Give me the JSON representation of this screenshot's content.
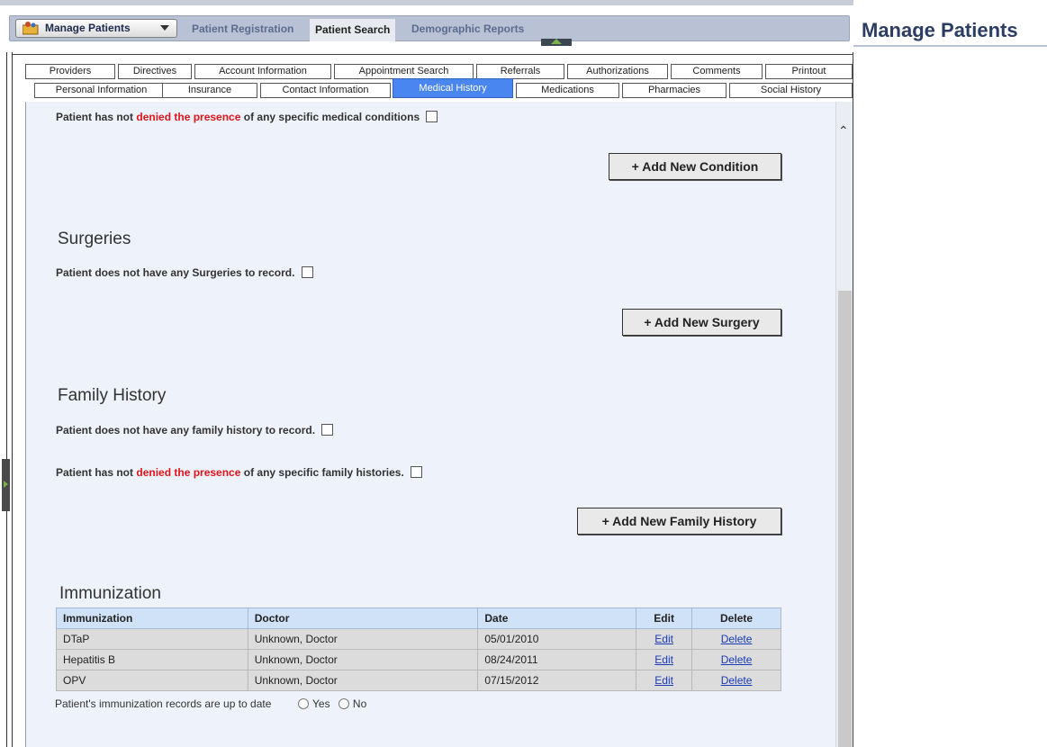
{
  "nav": {
    "manage_button": "Manage Patients",
    "links": [
      "Patient Registration",
      "Patient Search",
      "Demographic Reports"
    ],
    "active_link": "Patient Search"
  },
  "page_title": "Manage Patients",
  "tabs": {
    "row1": [
      "Providers",
      "Directives",
      "Account Information",
      "Appointment Search",
      "Referrals",
      "Authorizations",
      "Comments",
      "Printout"
    ],
    "row2": [
      "Personal Information",
      "Insurance",
      "Contact Information",
      "Medical History",
      "Medications",
      "Pharmacies",
      "Social History"
    ],
    "active": "Medical History"
  },
  "conditions": {
    "denied_prefix": "Patient has not",
    "denied_highlight": "denied the presence",
    "denied_suffix": "of any specific medical conditions",
    "add_button": "+ Add New Condition"
  },
  "surgeries": {
    "heading": "Surgeries",
    "none_text": "Patient does not have any Surgeries to record.",
    "add_button": "+ Add New Surgery"
  },
  "family_history": {
    "heading": "Family History",
    "none_text": "Patient does not have any family history to record.",
    "denied_prefix": "Patient has not",
    "denied_highlight": "denied the presence",
    "denied_suffix": "of any specific family histories.",
    "add_button": "+ Add New Family History"
  },
  "immunization": {
    "heading": "Immunization",
    "columns": [
      "Immunization",
      "Doctor",
      "Date",
      "Edit",
      "Delete"
    ],
    "rows": [
      {
        "name": "DTaP",
        "doctor": "Unknown, Doctor",
        "date": "05/01/2010",
        "edit": "Edit",
        "delete": "Delete"
      },
      {
        "name": "Hepatitis B",
        "doctor": "Unknown, Doctor",
        "date": "08/24/2011",
        "edit": "Edit",
        "delete": "Delete"
      },
      {
        "name": "OPV",
        "doctor": "Unknown, Doctor",
        "date": "07/15/2012",
        "edit": "Edit",
        "delete": "Delete"
      }
    ],
    "uptodate_label": "Patient's immunization records are up to date",
    "yes_label": "Yes",
    "no_label": "No"
  },
  "colors": {
    "accent_tab": "#4a86f0",
    "highlight_red": "#e2141a",
    "title": "#2b3d62"
  }
}
